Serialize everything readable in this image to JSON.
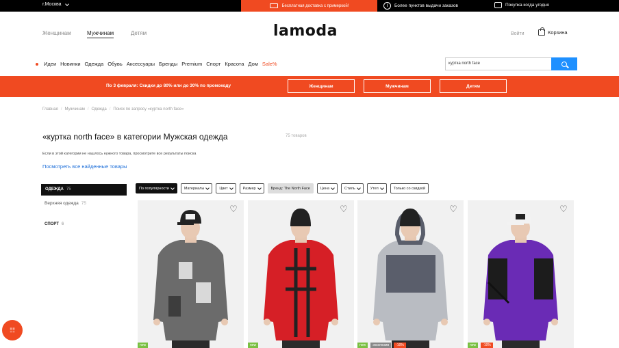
{
  "topbar": {
    "city": "г.Москва",
    "promo": "Бесплатная доставка с примеркой!",
    "item1": "Более пунктов выдачи заказов",
    "item2": "Покупка когда угодно"
  },
  "header": {
    "genders": [
      "Женщинам",
      "Мужчинам",
      "Детям"
    ],
    "logo": "lamoda",
    "login": "Войти",
    "cart": "Корзина"
  },
  "nav": {
    "items": [
      "Идеи",
      "Новинки",
      "Одежда",
      "Обувь",
      "Аксессуары",
      "Бренды",
      "Premium",
      "Спорт",
      "Красота",
      "Дом"
    ],
    "sale": "Sale%"
  },
  "search": {
    "value": "куртка north face"
  },
  "banner": {
    "text": "По 3 февраля: Скидки до 80% или до 30% по промокоду",
    "buttons": [
      "Женщинам",
      "Мужчинам",
      "Детям"
    ]
  },
  "breadcrumbs": [
    "Главная",
    "Мужчинам",
    "Одежда",
    "Поиск по запросу «куртка north face»"
  ],
  "page": {
    "title": "«куртка north face» в категории Мужская одежда",
    "count": "75 товаров",
    "note": "Если в этой категории не нашлось нужного товара, просмотрите все результаты поиска",
    "all_link": "Посмотреть все найденные товары"
  },
  "sidebar": {
    "active": {
      "label": "ОДЕЖДА",
      "count": "75"
    },
    "sub": {
      "label": "Верхняя одежда",
      "count": "75"
    },
    "sport": {
      "label": "СПОРТ",
      "count": "6"
    }
  },
  "filters": [
    {
      "label": "По популярности",
      "style": "dark"
    },
    {
      "label": "Материалы",
      "style": "normal"
    },
    {
      "label": "Цвет",
      "style": "normal"
    },
    {
      "label": "Размер",
      "style": "normal"
    },
    {
      "label": "Бренд: The North Face",
      "style": "grey"
    },
    {
      "label": "Цена",
      "style": "normal"
    },
    {
      "label": "Стиль",
      "style": "normal"
    },
    {
      "label": "Утеп",
      "style": "normal"
    },
    {
      "label": "Только со скидкой",
      "style": "plain"
    }
  ],
  "products": [
    {
      "badges": [
        {
          "text": "new",
          "color": "green"
        }
      ],
      "jacket": "#6b6b6b",
      "accent": "#d9d9d9",
      "hat": "#222"
    },
    {
      "badges": [
        {
          "text": "new",
          "color": "green"
        }
      ],
      "jacket": "#d61f26",
      "accent": "#222",
      "hat": "#222"
    },
    {
      "badges": [
        {
          "text": "new",
          "color": "green"
        },
        {
          "text": "эксклюзив",
          "color": "grey"
        },
        {
          "text": "-10%",
          "color": "red"
        }
      ],
      "jacket": "#b9bcc2",
      "accent": "#5a5e6b",
      "hat": "#222"
    },
    {
      "badges": [
        {
          "text": "new",
          "color": "green"
        },
        {
          "text": "-10%",
          "color": "red"
        }
      ],
      "jacket": "#6a2bb5",
      "accent": "#1c1c1c",
      "hat": "#f2f2f2"
    }
  ],
  "fab_icon": "filter-grid-icon"
}
